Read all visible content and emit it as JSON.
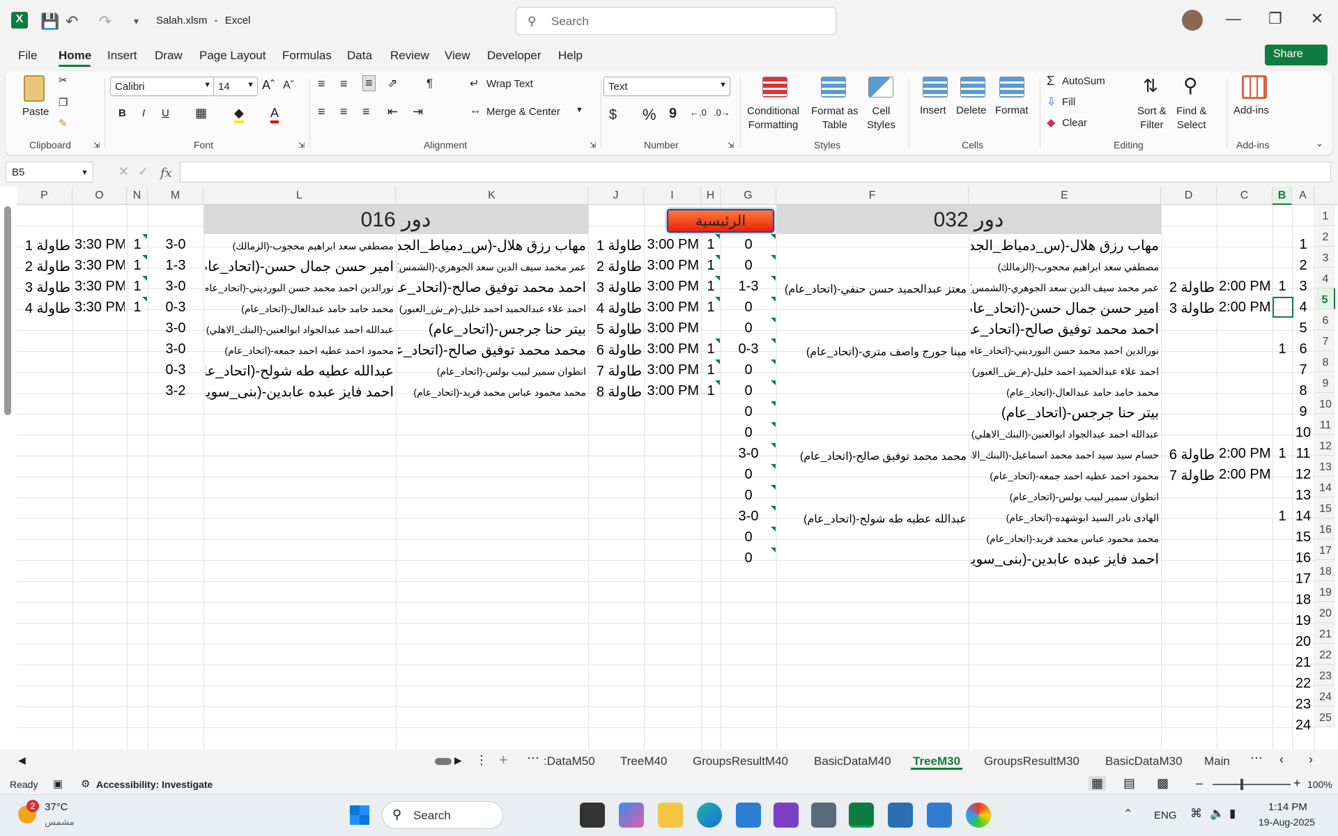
{
  "titlebar": {
    "filename": "Salah.xlsm",
    "separator": "-",
    "app": "Excel",
    "search_placeholder": "Search"
  },
  "menu": {
    "items": [
      "File",
      "Home",
      "Insert",
      "Draw",
      "Page Layout",
      "Formulas",
      "Data",
      "Review",
      "View",
      "Developer",
      "Help"
    ],
    "share": "Share"
  },
  "ribbon": {
    "clipboard": {
      "paste": "Paste",
      "label": "Clipboard"
    },
    "font": {
      "name": "Calibri",
      "size": "14",
      "label": "Font",
      "bold": "B",
      "italic": "I",
      "underline": "U"
    },
    "alignment": {
      "wrap": "Wrap Text",
      "merge": "Merge & Center",
      "label": "Alignment"
    },
    "number": {
      "format": "Text",
      "currency": "$",
      "percent": "%",
      "comma": "9",
      "label": "Number"
    },
    "styles": {
      "conditional": [
        "Conditional",
        "Formatting"
      ],
      "format_table": [
        "Format as",
        "Table"
      ],
      "cell_styles": [
        "Cell",
        "Styles"
      ],
      "label": "Styles"
    },
    "cells": {
      "insert": "Insert",
      "delete": "Delete",
      "format": "Format",
      "label": "Cells"
    },
    "editing": {
      "autosum": "AutoSum",
      "fill": "Fill",
      "clear": "Clear",
      "sort": [
        "Sort &",
        "Filter"
      ],
      "find": [
        "Find &",
        "Select"
      ],
      "label": "Editing"
    },
    "addins": {
      "addins": "Add-ins",
      "label": "Add-ins"
    }
  },
  "formula_bar": {
    "name_box": "B5",
    "fx": "fx",
    "value": ""
  },
  "columns": [
    "P",
    "O",
    "N",
    "M",
    "L",
    "K",
    "J",
    "I",
    "H",
    "G",
    "F",
    "E",
    "D",
    "C",
    "B",
    "A"
  ],
  "rows": [
    "1",
    "2",
    "3",
    "4",
    "5",
    "6",
    "7",
    "8",
    "9",
    "10",
    "11",
    "12",
    "13",
    "14",
    "15",
    "16",
    "17",
    "18",
    "19",
    "20",
    "21",
    "22",
    "23",
    "24",
    "25"
  ],
  "row_numbers_A": [
    "1",
    "2",
    "3",
    "4",
    "5",
    "6",
    "7",
    "8",
    "9",
    "10",
    "11",
    "12",
    "13",
    "14",
    "15",
    "16",
    "17",
    "18",
    "19",
    "20",
    "21",
    "22",
    "23",
    "24"
  ],
  "headers": {
    "right": "دور 032",
    "left": "دور 016",
    "main_button": "الرئيسية"
  },
  "sheet": {
    "E": [
      "مهاب رزق هلال-(س_دمياط_الجديدة)",
      "مصطفي سعد ابراهيم محجوب-(الزمالك)",
      "عمر محمد سيف الدين سعد الجوهري-(الشمس)",
      "امير حسن جمال حسن-(اتحاد_عام)",
      "احمد محمد توفيق صالح-(اتحاد_عام)",
      "نورالدين احمد محمد حسن البورديني-(اتحاد_عام)",
      "احمد علاء عبدالحميد احمد خليل-(م_ش_العبور)",
      "محمد حامد حامد عبدالعال-(اتحاد_عام)",
      "بيتر حنا جرجس-(اتحاد_عام)",
      "عبدالله احمد عبدالجواد ابوالعنين-(البنك_الاهلي)",
      "حسام سيد سيد احمد محمد اسماعيل-(البنك_الاهلي)",
      "محمود احمد عطيه احمد جمعه-(اتحاد_عام)",
      "انطوان سمير لبيب بولس-(اتحاد_عام)",
      "الهادى نادر السيد ابوشهده-(اتحاد_عام)",
      "محمد محمود عباس محمد فريد-(اتحاد_عام)",
      "احمد فايز عبده عابدين-(بنى_سويف)"
    ],
    "F": {
      "r4": "معتز عبدالحميد حسن حنفي-(اتحاد_عام)",
      "r7": "مينا جورج واصف متري-(اتحاد_عام)",
      "r12": "محمد محمد توفيق صالح-(اتحاد_عام)",
      "r15": "عبدالله عطيه طه شولح-(اتحاد_عام)"
    },
    "G": [
      "0",
      "0",
      "1-3",
      "0",
      "0",
      "0-3",
      "0",
      "0",
      "0",
      "0",
      "3-0",
      "0",
      "0",
      "3-0",
      "0",
      "0"
    ],
    "D": {
      "r4": "طاولة 2",
      "r5": "طاولة 3",
      "r12": "طاولة 6",
      "r13": "طاولة 7"
    },
    "C": {
      "r4": "2:00 PM",
      "r5": "2:00 PM",
      "r12": "2:00 PM",
      "r13": "2:00 PM"
    },
    "B": {
      "r4": "1",
      "r7": "1",
      "r12": "1",
      "r15": "1"
    },
    "K": [
      "مهاب رزق هلال-(س_دمياط_الجديدة)",
      "عمر محمد سيف الدين سعد الجوهري-(الشمس)",
      "احمد محمد توفيق صالح-(اتحاد_عام)",
      "احمد علاء عبدالحميد احمد خليل-(م_ش_العبور)",
      "بيتر حنا جرجس-(اتحاد_عام)",
      "محمد محمد توفيق صالح-(اتحاد_عام)",
      "انطوان سمير لبيب بولس-(اتحاد_عام)",
      "محمد محمود عباس محمد فريد-(اتحاد_عام)"
    ],
    "J": [
      "طاولة 1",
      "طاولة 2",
      "طاولة 3",
      "طاولة 4",
      "طاولة 5",
      "طاولة 6",
      "طاولة 7",
      "طاولة 8"
    ],
    "I": [
      "3:00 PM",
      "3:00 PM",
      "3:00 PM",
      "3:00 PM",
      "3:00 PM",
      "3:00 PM",
      "3:00 PM",
      "3:00 PM"
    ],
    "H": [
      "1",
      "1",
      "1",
      "1",
      "",
      "1",
      "1",
      "1"
    ],
    "L": [
      "مصطفي سعد ابراهيم محجوب-(الزمالك)",
      "امير حسن جمال حسن-(اتحاد_عام)",
      "نورالدين احمد محمد حسن البورديني-(اتحاد_عام)",
      "محمد حامد حامد عبدالعال-(اتحاد_عام)",
      "عبدالله احمد عبدالجواد ابوالعنين-(البنك_الاهلي)",
      "محمود احمد عطيه احمد جمعه-(اتحاد_عام)",
      "عبدالله عطيه طه شولح-(اتحاد_عام)",
      "احمد فايز عبده عابدين-(بنى_سويف)"
    ],
    "M": [
      "3-0",
      "1-3",
      "3-0",
      "0-3",
      "3-0",
      "3-0",
      "0-3",
      "3-2"
    ],
    "N": [
      "1",
      "1",
      "1",
      "1"
    ],
    "O": [
      "3:30 PM",
      "3:30 PM",
      "3:30 PM",
      "3:30 PM"
    ],
    "P": [
      "طاولة 1",
      "طاولة 2",
      "طاولة 3",
      "طاولة 4"
    ]
  },
  "tabs": [
    ":DataM50",
    "TreeM40",
    "GroupsResultM40",
    "BasicDataM40",
    "TreeM30",
    "GroupsResultM30",
    "BasicDataM30",
    "Main"
  ],
  "status": {
    "ready": "Ready",
    "accessibility": "Accessibility: Investigate",
    "zoom": "100%"
  },
  "taskbar": {
    "temp": "37°C",
    "weather": "مشمس",
    "badge": "2",
    "search": "Search",
    "lang": "ENG",
    "time": "1:14 PM",
    "date": "19-Aug-2025"
  }
}
